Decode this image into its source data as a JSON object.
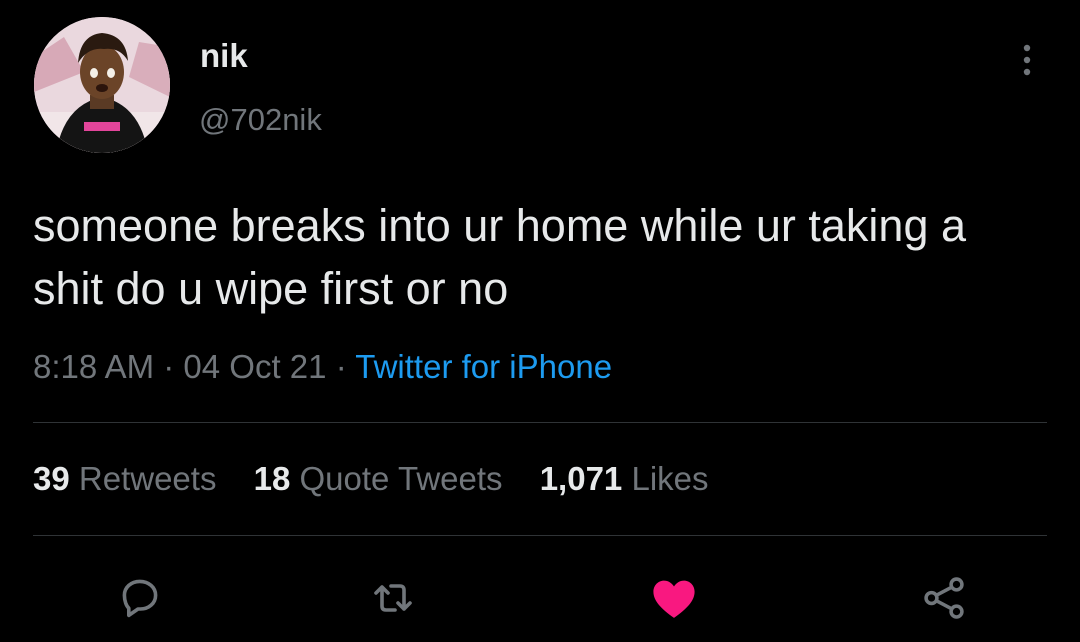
{
  "user": {
    "display_name": "nik",
    "handle": "@702nik"
  },
  "tweet": {
    "text": "someone breaks into ur home while ur taking a shit do u wipe first or no",
    "time": "8:18 AM",
    "date": "04 Oct 21",
    "separator": "·",
    "source": "Twitter for iPhone"
  },
  "stats": {
    "retweets_count": "39",
    "retweets_label": "Retweets",
    "quotes_count": "18",
    "quotes_label": "Quote Tweets",
    "likes_count": "1,071",
    "likes_label": "Likes"
  },
  "colors": {
    "background": "#000000",
    "text": "#e7e9ea",
    "secondary": "#71767b",
    "link": "#1d9bf0",
    "like": "#f91880",
    "divider": "#2f3336"
  },
  "icons": {
    "more": "more-vertical-icon",
    "reply": "reply-icon",
    "retweet": "retweet-icon",
    "like": "heart-icon",
    "share": "share-icon"
  }
}
